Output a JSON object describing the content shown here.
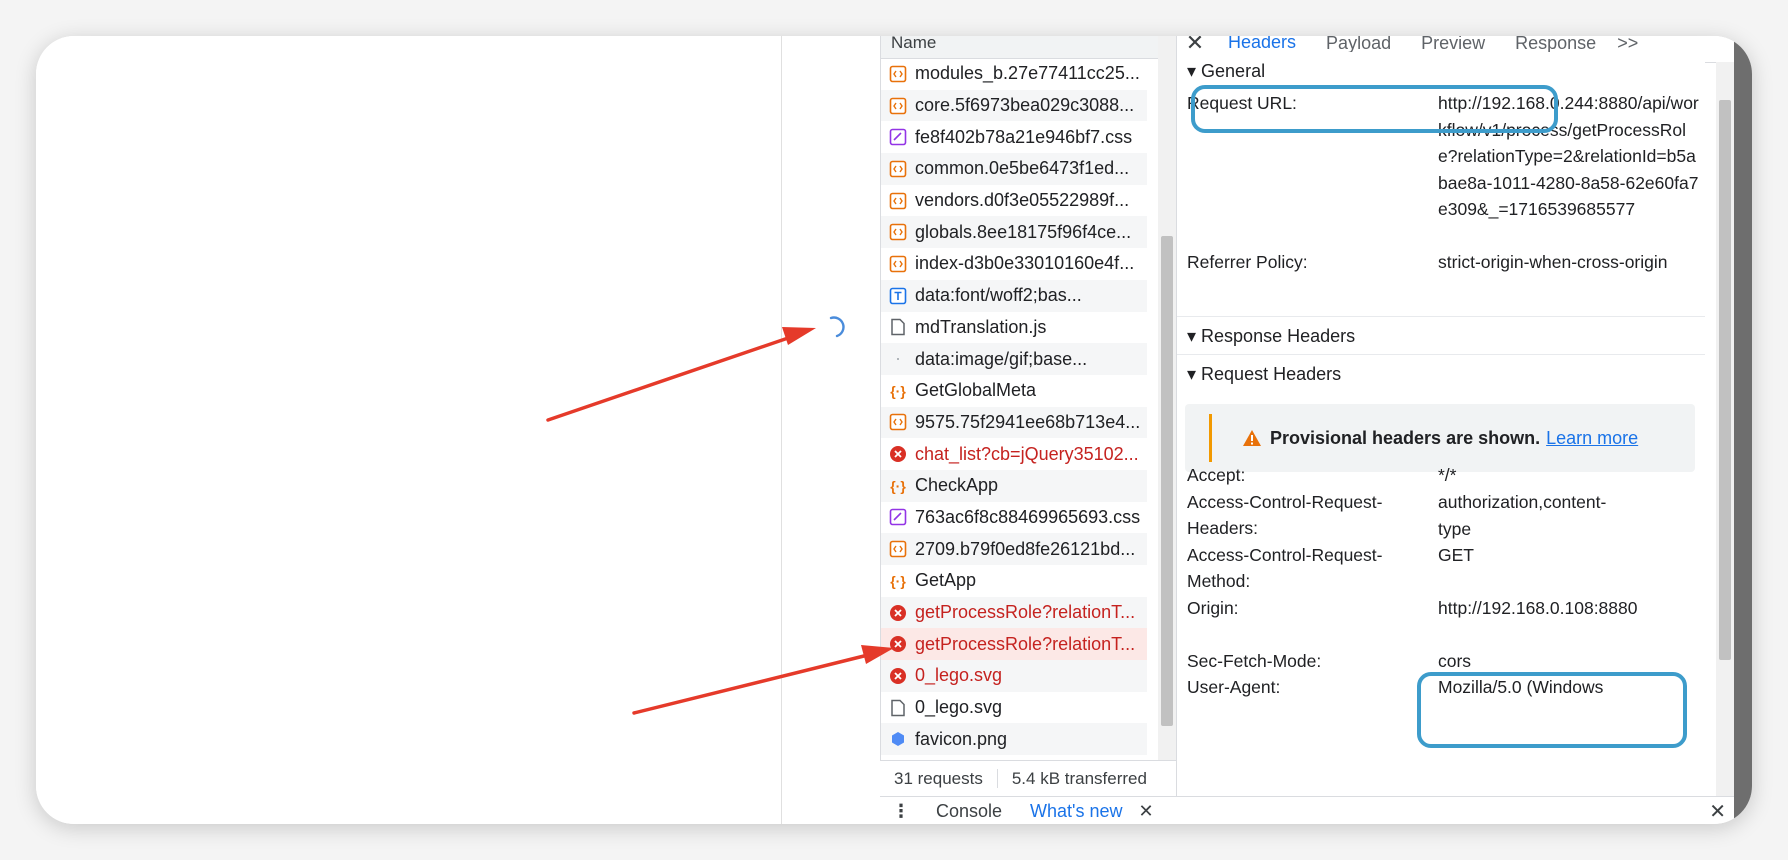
{
  "network": {
    "column_name": "Name",
    "rows": [
      {
        "name": "modules_b.27e77411cc25...",
        "type": "script",
        "error": false,
        "selected": false
      },
      {
        "name": "core.5f6973bea029c3088...",
        "type": "script",
        "error": false,
        "selected": false
      },
      {
        "name": "fe8f402b78a21e946bf7.css",
        "type": "stylesheet",
        "error": false,
        "selected": false
      },
      {
        "name": "common.0e5be6473f1ed...",
        "type": "script",
        "error": false,
        "selected": false
      },
      {
        "name": "vendors.d0f3e05522989f...",
        "type": "script",
        "error": false,
        "selected": false
      },
      {
        "name": "globals.8ee18175f96f4ce...",
        "type": "script",
        "error": false,
        "selected": false
      },
      {
        "name": "index-d3b0e33010160e4f...",
        "type": "script",
        "error": false,
        "selected": false
      },
      {
        "name": "data:font/woff2;bas...",
        "type": "font",
        "error": false,
        "selected": false
      },
      {
        "name": "mdTranslation.js",
        "type": "document",
        "error": false,
        "selected": false
      },
      {
        "name": "data:image/gif;base...",
        "type": "image-dot",
        "error": false,
        "selected": false
      },
      {
        "name": "GetGlobalMeta",
        "type": "fetch",
        "error": false,
        "selected": false
      },
      {
        "name": "9575.75f2941ee68b713e4...",
        "type": "script",
        "error": false,
        "selected": false
      },
      {
        "name": "chat_list?cb=jQuery35102...",
        "type": "error",
        "error": true,
        "selected": false
      },
      {
        "name": "CheckApp",
        "type": "fetch",
        "error": false,
        "selected": false
      },
      {
        "name": "763ac6f8c88469965693.css",
        "type": "stylesheet",
        "error": false,
        "selected": false
      },
      {
        "name": "2709.b79f0ed8fe26121bd...",
        "type": "script",
        "error": false,
        "selected": false
      },
      {
        "name": "GetApp",
        "type": "fetch",
        "error": false,
        "selected": false
      },
      {
        "name": "getProcessRole?relationT...",
        "type": "error",
        "error": true,
        "selected": false
      },
      {
        "name": "getProcessRole?relationT...",
        "type": "error",
        "error": true,
        "selected": true
      },
      {
        "name": "0_lego.svg",
        "type": "error",
        "error": true,
        "selected": false
      },
      {
        "name": "0_lego.svg",
        "type": "document",
        "error": false,
        "selected": false
      },
      {
        "name": "favicon.png",
        "type": "image",
        "error": false,
        "selected": false
      }
    ],
    "footer": {
      "requests": "31 requests",
      "transferred": "5.4 kB transferred"
    }
  },
  "details": {
    "tabs": [
      "Headers",
      "Payload",
      "Preview",
      "Response"
    ],
    "more": ">>",
    "general": {
      "title": "▾ General",
      "request_url_label": "Request URL:",
      "request_url_value": "http://192.168.0.244:8880/api/workflow/v1/process/getProcessRole?relationType=2&relationId=b5abae8a-1011-4280-8a58-62e60fa7e309&_=1716539685577",
      "referrer_label": "Referrer Policy:",
      "referrer_value": "strict-origin-when-cross-origin"
    },
    "response_headers_title": "▾ Response Headers",
    "request_headers_title": "▾ Request Headers",
    "warning": {
      "text": "Provisional headers are shown.",
      "link": "Learn more"
    },
    "request_headers": {
      "accept_k": "Accept:",
      "accept_v": "*/*",
      "acrh_k": "Access-Control-Request-Headers:",
      "acrh_v": "authorization,content-type",
      "acrm_k": "Access-Control-Request-Method:",
      "acrm_v": "GET",
      "origin_k": "Origin:",
      "origin_v": "http://192.168.0.108:8880",
      "sfm_k": "Sec-Fetch-Mode:",
      "sfm_v": "cors",
      "ua_k": "User-Agent:",
      "ua_v": "Mozilla/5.0 (Windows"
    }
  },
  "drawer": {
    "console": "Console",
    "whats_new": "What's new"
  },
  "colors": {
    "accent": "#1a73e8",
    "error": "#c5221f",
    "highlight": "#3d9ccb",
    "arrow": "#e53a2a"
  }
}
